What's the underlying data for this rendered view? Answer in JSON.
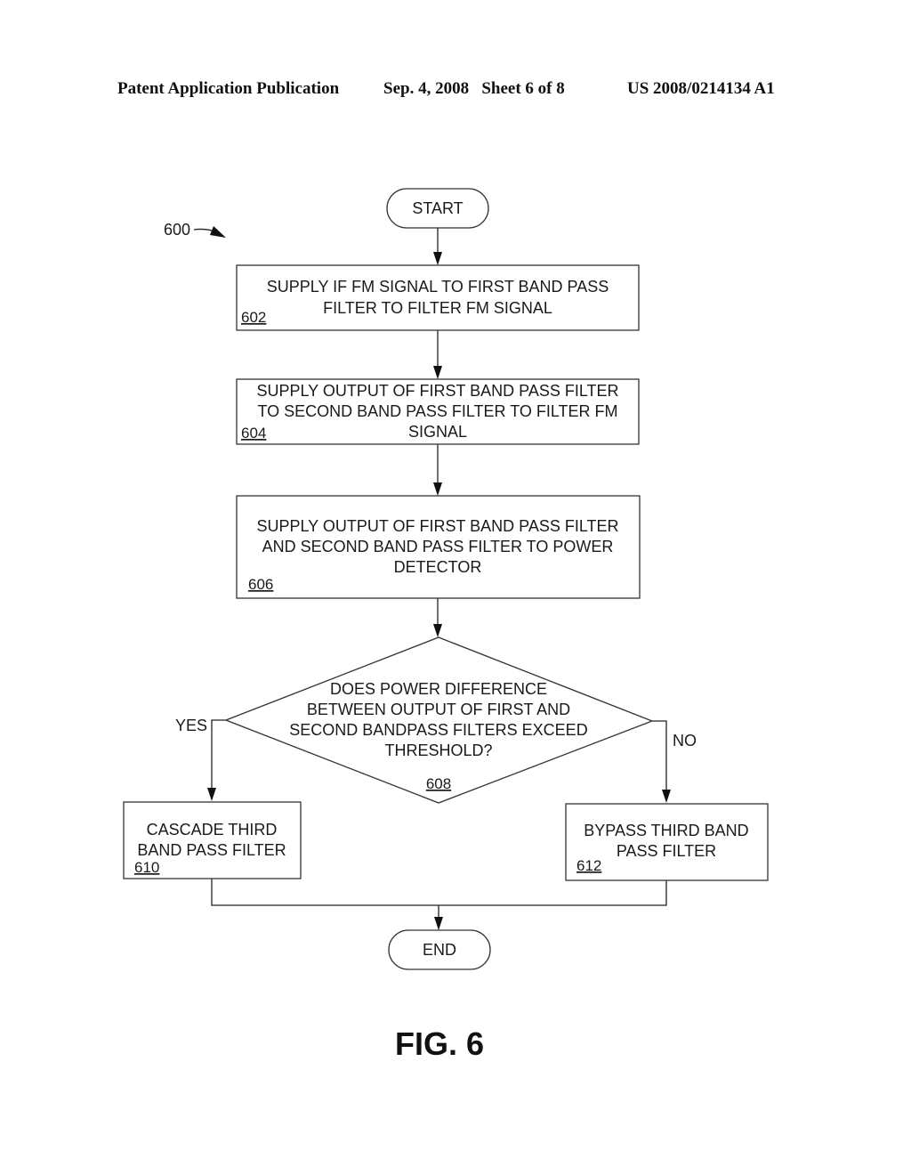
{
  "header": {
    "publication": "Patent Application Publication",
    "date_sheet": "Sep. 4, 2008   Sheet 6 of 8",
    "patent_number": "US 2008/0214134 A1"
  },
  "diagram": {
    "ref_number": "600",
    "start_label": "START",
    "end_label": "END",
    "steps": [
      {
        "id": "602",
        "lines": [
          "SUPPLY IF FM SIGNAL TO FIRST BAND PASS",
          "FILTER TO FILTER FM SIGNAL"
        ]
      },
      {
        "id": "604",
        "lines": [
          "SUPPLY OUTPUT OF FIRST BAND PASS FILTER",
          "TO SECOND BAND PASS FILTER TO FILTER FM",
          "SIGNAL"
        ]
      },
      {
        "id": "606",
        "lines": [
          "SUPPLY OUTPUT OF FIRST BAND PASS FILTER",
          "AND SECOND BAND PASS FILTER TO POWER",
          "DETECTOR"
        ]
      }
    ],
    "decision": {
      "id": "608",
      "lines": [
        "DOES POWER DIFFERENCE",
        "BETWEEN OUTPUT OF FIRST AND",
        "SECOND BANDPASS FILTERS EXCEED",
        "THRESHOLD?"
      ],
      "yes_label": "YES",
      "no_label": "NO"
    },
    "yes_step": {
      "id": "610",
      "lines": [
        "CASCADE THIRD",
        "BAND PASS FILTER"
      ]
    },
    "no_step": {
      "id": "612",
      "lines": [
        "BYPASS THIRD BAND",
        "PASS FILTER"
      ]
    },
    "figure_label": "FIG. 6"
  }
}
